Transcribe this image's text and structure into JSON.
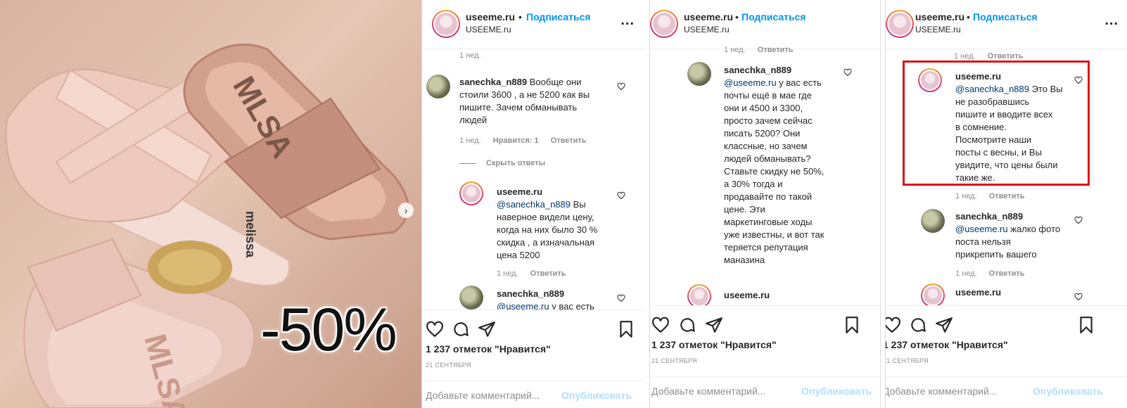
{
  "photo": {
    "promo_text": "-50%",
    "brand_stamp": "MLSA",
    "next_icon": "chevron-right-icon"
  },
  "post": {
    "username": "useeme.ru",
    "dot": "•",
    "follow_label": "Подписаться",
    "subtitle": "USEEME.ru",
    "more": "...",
    "likes": "1 237 отметок \"Нравится\"",
    "date": "21 СЕНТЯБРЯ",
    "comment_placeholder": "Добавьте комментарий...",
    "publish_label": "Опубликовать"
  },
  "panel1": {
    "top_meta": {
      "time": "1 нед."
    },
    "c1": {
      "user": "sanechka_n889",
      "text_a": "Вообще они",
      "text_b": "стоили 3600 , а не 5200 как вы",
      "text_c": "пишите. Зачем обманывать",
      "text_d": "людей",
      "time": "1 нед.",
      "likes": "Нравится: 1",
      "reply": "Ответить"
    },
    "hide_replies": "Скрыть ответы",
    "c2": {
      "user": "useeme.ru",
      "mention": "@sanechka_n889",
      "l1": "Вы",
      "l2": "наверное видели цену,",
      "l3": "когда на них было 30 %",
      "l4": "скидка , а изначальная",
      "l5": "цена 5200",
      "time": "1 нед.",
      "reply": "Ответить"
    },
    "c3": {
      "user": "sanechka_n889",
      "mention": "@useeme.ru",
      "l1": "у вас есть"
    }
  },
  "panel2": {
    "top_meta": {
      "time": "1 нед.",
      "reply": "Ответить"
    },
    "c1": {
      "user": "sanechka_n889",
      "mention": "@useeme.ru",
      "lines": [
        "у вас есть",
        "почты ещё в мае где",
        "они и 4500 и 3300,",
        "просто зачем сейчас",
        "писать 5200? Они",
        "классные, но зачем",
        "людей обманывать?",
        "Ставьте скидку не 50%,",
        "а 30% тогда и",
        "продавайте по такой",
        "цене. Эти",
        "маркетинговые ходы",
        "уже известны, и вот так",
        "теряется репутация",
        "маназина"
      ]
    },
    "c2": {
      "user": "useeme.ru"
    }
  },
  "panel3": {
    "top_meta": {
      "time": "1 нед.",
      "reply": "Ответить"
    },
    "c1": {
      "user": "useeme.ru",
      "mention": "@sanechka_n889",
      "lines": [
        "Это Вы",
        "не разобравшись",
        "пишите и вводите всех",
        "в сомнение.",
        "Посмотрите наши",
        "посты с весны, и Вы",
        "увидите, что цены были",
        "такие же."
      ],
      "time": "1 нед.",
      "reply": "Ответить"
    },
    "c2": {
      "user": "sanechka_n889",
      "mention": "@useeme.ru",
      "lines": [
        "жалко фото",
        "поста нельзя",
        "прикрепить вашего"
      ],
      "time": "1 нед.",
      "reply": "Ответить"
    },
    "c3": {
      "user": "useeme.ru"
    }
  },
  "colors": {
    "accent": "#0095f6",
    "highlight": "#e0131a",
    "muted": "#8e8e8e",
    "publish_disabled": "#b2dffc"
  }
}
